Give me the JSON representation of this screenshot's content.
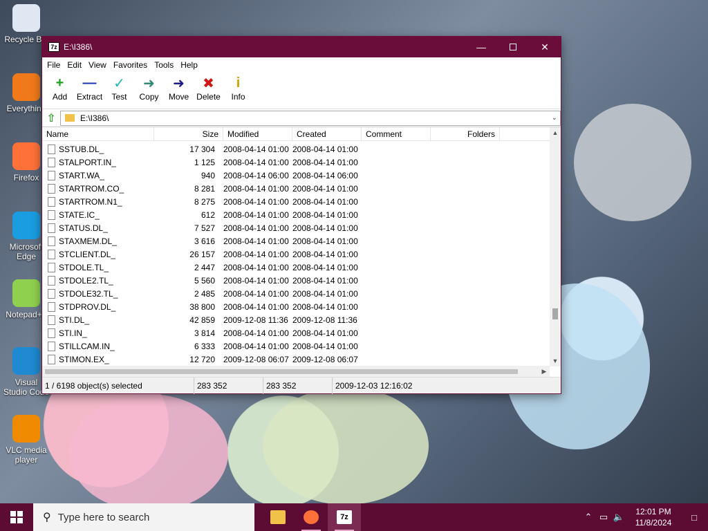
{
  "desktop": {
    "icons": [
      {
        "label": "Recycle Bin",
        "icon": "recycle-bin-icon",
        "color": "#dfe8f2"
      },
      {
        "label": "Everything",
        "icon": "everything-search-icon",
        "color": "#f07a1a"
      },
      {
        "label": "Firefox",
        "icon": "firefox-icon",
        "color": "#ff7139"
      },
      {
        "label": "Microsoft Edge",
        "icon": "edge-icon",
        "color": "#1b9de2"
      },
      {
        "label": "Notepad++",
        "icon": "notepad-plus-icon",
        "color": "#8fd14f"
      },
      {
        "label": "Visual Studio Code",
        "icon": "vscode-icon",
        "color": "#1f8ad2"
      },
      {
        "label": "VLC media player",
        "icon": "vlc-icon",
        "color": "#f08a00"
      }
    ]
  },
  "window": {
    "title": "E:\\I386\\",
    "app_icon_text": "7z",
    "menu": [
      "File",
      "Edit",
      "View",
      "Favorites",
      "Tools",
      "Help"
    ],
    "toolbar": [
      {
        "label": "Add",
        "glyph": "+",
        "color": "#1aa31a",
        "icon": "add-icon"
      },
      {
        "label": "Extract",
        "glyph": "—",
        "color": "#1a2fb8",
        "icon": "extract-icon"
      },
      {
        "label": "Test",
        "glyph": "✓",
        "color": "#1ab6b6",
        "icon": "test-icon"
      },
      {
        "label": "Copy",
        "glyph": "➜",
        "color": "#2e8a74",
        "icon": "copy-icon"
      },
      {
        "label": "Move",
        "glyph": "➜",
        "color": "#1a1a8e",
        "icon": "move-icon"
      },
      {
        "label": "Delete",
        "glyph": "✖",
        "color": "#d01616",
        "icon": "delete-icon"
      },
      {
        "label": "Info",
        "glyph": "i",
        "color": "#c9a500",
        "icon": "info-icon"
      }
    ],
    "address": "E:\\I386\\",
    "columns": [
      "Name",
      "Size",
      "Modified",
      "Created",
      "Comment",
      "Folders"
    ],
    "files": [
      {
        "name": "SSTUB.DL_",
        "size": "17 304",
        "modified": "2008-04-14 01:00",
        "created": "2008-04-14 01:00"
      },
      {
        "name": "STALPORT.IN_",
        "size": "1 125",
        "modified": "2008-04-14 01:00",
        "created": "2008-04-14 01:00"
      },
      {
        "name": "START.WA_",
        "size": "940",
        "modified": "2008-04-14 06:00",
        "created": "2008-04-14 06:00"
      },
      {
        "name": "STARTROM.CO_",
        "size": "8 281",
        "modified": "2008-04-14 01:00",
        "created": "2008-04-14 01:00"
      },
      {
        "name": "STARTROM.N1_",
        "size": "8 275",
        "modified": "2008-04-14 01:00",
        "created": "2008-04-14 01:00"
      },
      {
        "name": "STATE.IC_",
        "size": "612",
        "modified": "2008-04-14 01:00",
        "created": "2008-04-14 01:00"
      },
      {
        "name": "STATUS.DL_",
        "size": "7 527",
        "modified": "2008-04-14 01:00",
        "created": "2008-04-14 01:00"
      },
      {
        "name": "STAXMEM.DL_",
        "size": "3 616",
        "modified": "2008-04-14 01:00",
        "created": "2008-04-14 01:00"
      },
      {
        "name": "STCLIENT.DL_",
        "size": "26 157",
        "modified": "2008-04-14 01:00",
        "created": "2008-04-14 01:00"
      },
      {
        "name": "STDOLE.TL_",
        "size": "2 447",
        "modified": "2008-04-14 01:00",
        "created": "2008-04-14 01:00"
      },
      {
        "name": "STDOLE2.TL_",
        "size": "5 560",
        "modified": "2008-04-14 01:00",
        "created": "2008-04-14 01:00"
      },
      {
        "name": "STDOLE32.TL_",
        "size": "2 485",
        "modified": "2008-04-14 01:00",
        "created": "2008-04-14 01:00"
      },
      {
        "name": "STDPROV.DL_",
        "size": "38 800",
        "modified": "2008-04-14 01:00",
        "created": "2008-04-14 01:00"
      },
      {
        "name": "STI.DL_",
        "size": "42 859",
        "modified": "2009-12-08 11:36",
        "created": "2009-12-08 11:36"
      },
      {
        "name": "STI.IN_",
        "size": "3 814",
        "modified": "2008-04-14 01:00",
        "created": "2008-04-14 01:00"
      },
      {
        "name": "STILLCAM.IN_",
        "size": "6 333",
        "modified": "2008-04-14 01:00",
        "created": "2008-04-14 01:00"
      },
      {
        "name": "STIMON.EX_",
        "size": "12 720",
        "modified": "2009-12-08 06:07",
        "created": "2009-12-08 06:07"
      }
    ],
    "status": {
      "selection": "1 / 6198 object(s) selected",
      "size": "283 352",
      "packed": "283 352",
      "date": "2009-12-03 12:16:02"
    }
  },
  "taskbar": {
    "search_placeholder": "Type here to search",
    "time": "12:01 PM",
    "date": "11/8/2024",
    "apps": [
      {
        "name": "file-explorer-icon",
        "color": "#f0c24a"
      },
      {
        "name": "firefox-icon",
        "color": "#ff7139"
      },
      {
        "name": "7zip-icon",
        "color": "#ffffff",
        "text": "7z"
      }
    ]
  }
}
